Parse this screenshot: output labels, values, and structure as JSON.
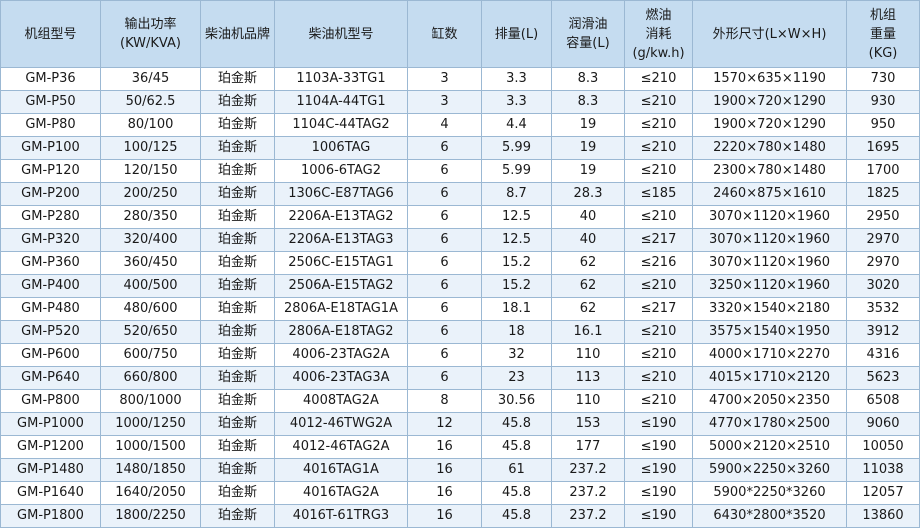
{
  "headers": [
    {
      "lines": [
        "机组型号"
      ]
    },
    {
      "lines": [
        "输出功率",
        "(KW/KVA)"
      ]
    },
    {
      "lines": [
        "柴油机品牌"
      ]
    },
    {
      "lines": [
        "柴油机型号"
      ]
    },
    {
      "lines": [
        "缸数"
      ]
    },
    {
      "lines": [
        "排量(L)"
      ]
    },
    {
      "lines": [
        "润滑油",
        "容量(L)"
      ]
    },
    {
      "lines": [
        "燃油",
        "消耗",
        "(g/kw.h)"
      ]
    },
    {
      "lines": [
        "外形尺寸(L×W×H)"
      ]
    },
    {
      "lines": [
        "机组",
        "重量",
        "(KG)"
      ]
    }
  ],
  "rows": [
    [
      "GM-P36",
      "36/45",
      "珀金斯",
      "1103A-33TG1",
      "3",
      "3.3",
      "8.3",
      "≤210",
      "1570×635×1190",
      "730"
    ],
    [
      "GM-P50",
      "50/62.5",
      "珀金斯",
      "1104A-44TG1",
      "3",
      "3.3",
      "8.3",
      "≤210",
      "1900×720×1290",
      "930"
    ],
    [
      "GM-P80",
      "80/100",
      "珀金斯",
      "1104C-44TAG2",
      "4",
      "4.4",
      "19",
      "≤210",
      "1900×720×1290",
      "950"
    ],
    [
      "GM-P100",
      "100/125",
      "珀金斯",
      "1006TAG",
      "6",
      "5.99",
      "19",
      "≤210",
      "2220×780×1480",
      "1695"
    ],
    [
      "GM-P120",
      "120/150",
      "珀金斯",
      "1006-6TAG2",
      "6",
      "5.99",
      "19",
      "≤210",
      "2300×780×1480",
      "1700"
    ],
    [
      "GM-P200",
      "200/250",
      "珀金斯",
      "1306C-E87TAG6",
      "6",
      "8.7",
      "28.3",
      "≤185",
      "2460×875×1610",
      "1825"
    ],
    [
      "GM-P280",
      "280/350",
      "珀金斯",
      "2206A-E13TAG2",
      "6",
      "12.5",
      "40",
      "≤210",
      "3070×1120×1960",
      "2950"
    ],
    [
      "GM-P320",
      "320/400",
      "珀金斯",
      "2206A-E13TAG3",
      "6",
      "12.5",
      "40",
      "≤217",
      "3070×1120×1960",
      "2970"
    ],
    [
      "GM-P360",
      "360/450",
      "珀金斯",
      "2506C-E15TAG1",
      "6",
      "15.2",
      "62",
      "≤216",
      "3070×1120×1960",
      "2970"
    ],
    [
      "GM-P400",
      "400/500",
      "珀金斯",
      "2506A-E15TAG2",
      "6",
      "15.2",
      "62",
      "≤210",
      "3250×1120×1960",
      "3020"
    ],
    [
      "GM-P480",
      "480/600",
      "珀金斯",
      "2806A-E18TAG1A",
      "6",
      "18.1",
      "62",
      "≤217",
      "3320×1540×2180",
      "3532"
    ],
    [
      "GM-P520",
      "520/650",
      "珀金斯",
      "2806A-E18TAG2",
      "6",
      "18",
      "16.1",
      "≤210",
      "3575×1540×1950",
      "3912"
    ],
    [
      "GM-P600",
      "600/750",
      "珀金斯",
      "4006-23TAG2A",
      "6",
      "32",
      "110",
      "≤210",
      "4000×1710×2270",
      "4316"
    ],
    [
      "GM-P640",
      "660/800",
      "珀金斯",
      "4006-23TAG3A",
      "6",
      "23",
      "113",
      "≤210",
      "4015×1710×2120",
      "5623"
    ],
    [
      "GM-P800",
      "800/1000",
      "珀金斯",
      "4008TAG2A",
      "8",
      "30.56",
      "110",
      "≤210",
      "4700×2050×2350",
      "6508"
    ],
    [
      "GM-P1000",
      "1000/1250",
      "珀金斯",
      "4012-46TWG2A",
      "12",
      "45.8",
      "153",
      "≤190",
      "4770×1780×2500",
      "9060"
    ],
    [
      "GM-P1200",
      "1000/1500",
      "珀金斯",
      "4012-46TAG2A",
      "16",
      "45.8",
      "177",
      "≤190",
      "5000×2120×2510",
      "10050"
    ],
    [
      "GM-P1480",
      "1480/1850",
      "珀金斯",
      "4016TAG1A",
      "16",
      "61",
      "237.2",
      "≤190",
      "5900×2250×3260",
      "11038"
    ],
    [
      "GM-P1640",
      "1640/2050",
      "珀金斯",
      "4016TAG2A",
      "16",
      "45.8",
      "237.2",
      "≤190",
      "5900*2250*3260",
      "12057"
    ],
    [
      "GM-P1800",
      "1800/2250",
      "珀金斯",
      "4016T-61TRG3",
      "16",
      "45.8",
      "237.2",
      "≤190",
      "6430*2800*3520",
      "13860"
    ]
  ],
  "colors": {
    "header_bg": "#c5dcf0",
    "row_alt_bg": "#eaf2fa",
    "border": "#9bb8d3",
    "text": "#1a1a1a"
  }
}
